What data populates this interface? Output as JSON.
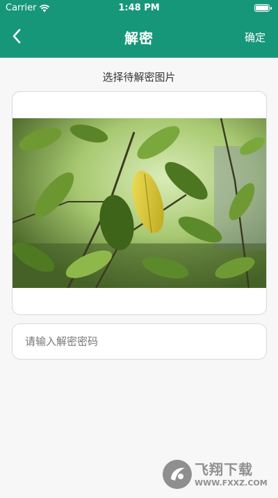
{
  "status_bar": {
    "carrier": "Carrier",
    "time": "1:48 PM",
    "battery_level": 1.0
  },
  "nav": {
    "back_icon": "chevron-left-icon",
    "title": "解密",
    "confirm_label": "确定"
  },
  "content": {
    "prompt": "选择待解密图片",
    "selected_image": "photo of green leaves with one yellow leaf",
    "password_placeholder": "请输入解密密码",
    "password_value": ""
  },
  "watermark": {
    "main_text": "飞翔下载",
    "sub_text": "WWW.FXXZ.COM"
  },
  "colors": {
    "header_bg": "#16977a",
    "page_bg": "#f7f7f7",
    "card_border": "#d9d9d9"
  }
}
